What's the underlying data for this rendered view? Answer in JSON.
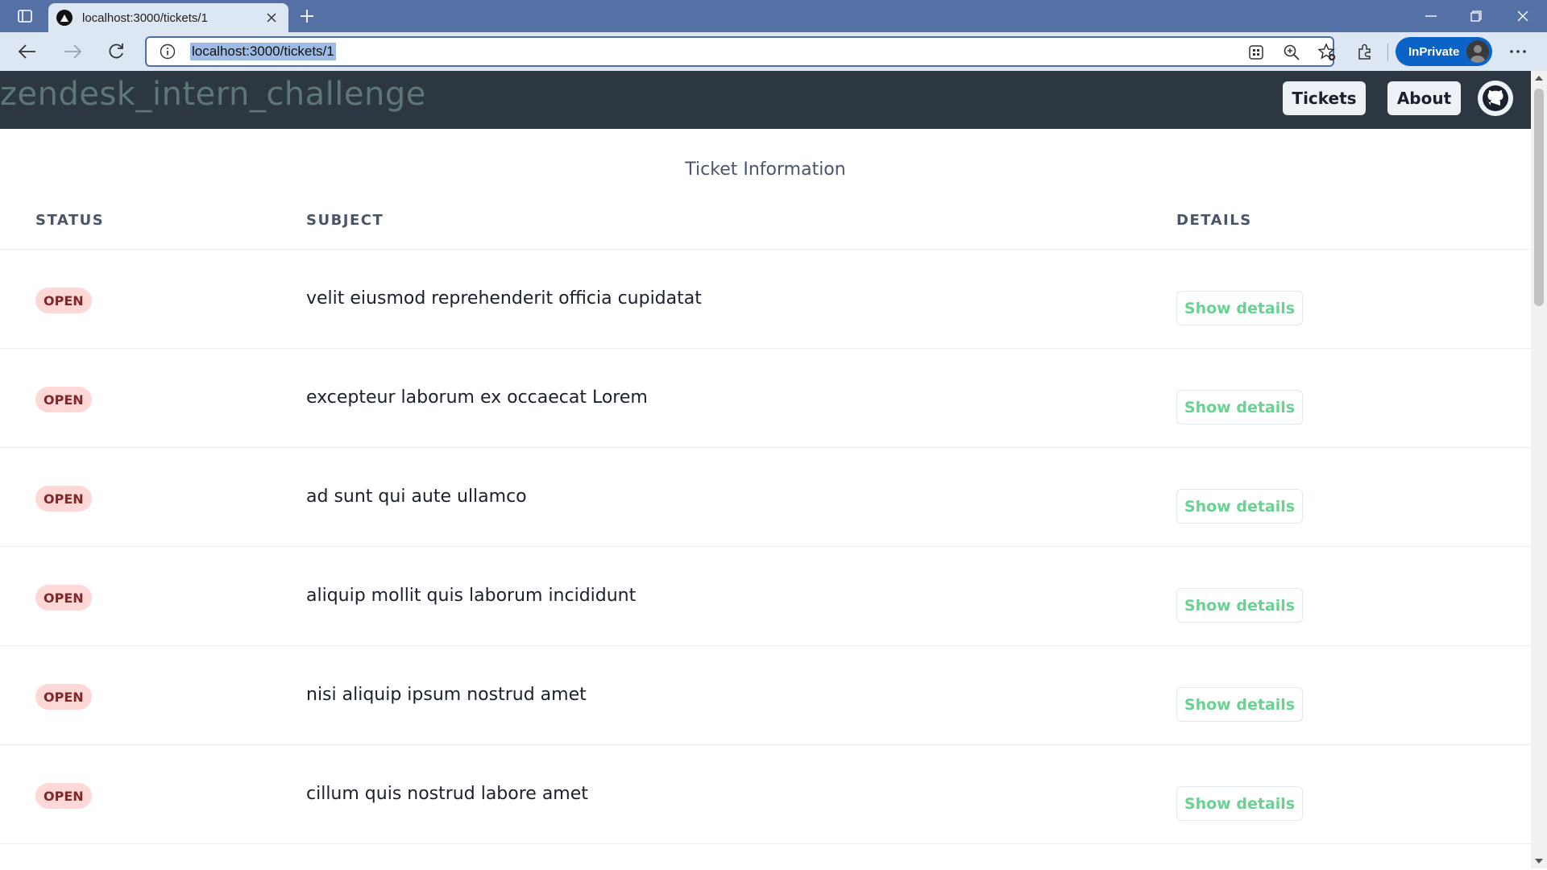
{
  "browser": {
    "tab_title": "localhost:3000/tickets/1",
    "url": "localhost:3000/tickets/1",
    "inprivate_label": "InPrivate"
  },
  "header": {
    "brand": "zendesk_intern_challenge",
    "nav": {
      "tickets": "Tickets",
      "about": "About"
    }
  },
  "table": {
    "caption": "Ticket Information",
    "columns": {
      "status": "STATUS",
      "subject": "SUBJECT",
      "details": "DETAILS"
    },
    "rows": [
      {
        "status": "OPEN",
        "subject": "velit eiusmod reprehenderit officia cupidatat",
        "action": "Show details"
      },
      {
        "status": "OPEN",
        "subject": "excepteur laborum ex occaecat Lorem",
        "action": "Show details"
      },
      {
        "status": "OPEN",
        "subject": "ad sunt qui aute ullamco",
        "action": "Show details"
      },
      {
        "status": "OPEN",
        "subject": "aliquip mollit quis laborum incididunt",
        "action": "Show details"
      },
      {
        "status": "OPEN",
        "subject": "nisi aliquip ipsum nostrud amet",
        "action": "Show details"
      },
      {
        "status": "OPEN",
        "subject": "cillum quis nostrud labore amet",
        "action": "Show details"
      }
    ]
  },
  "colors": {
    "header_bg": "#2d3741",
    "brand_text": "#5c7775",
    "badge_bg": "#fed7d7",
    "badge_text": "#822727",
    "details_text": "#68d391",
    "browser_tabbar": "#5470a5",
    "browser_toolbar": "#dde6f3",
    "inprivate": "#0b63c7"
  },
  "icons": {
    "tab_actions": "tab-actions-icon",
    "favicon": "nextjs-triangle-icon",
    "tab_close": "close-icon",
    "new_tab": "plus-icon",
    "back": "back-arrow-icon",
    "forward": "forward-arrow-icon",
    "refresh": "refresh-icon",
    "site_info": "info-icon",
    "apps": "apps-icon",
    "zoom": "zoom-icon",
    "favorites": "favorite-add-icon",
    "extensions": "extensions-icon",
    "more": "more-icon",
    "github": "github-icon"
  }
}
